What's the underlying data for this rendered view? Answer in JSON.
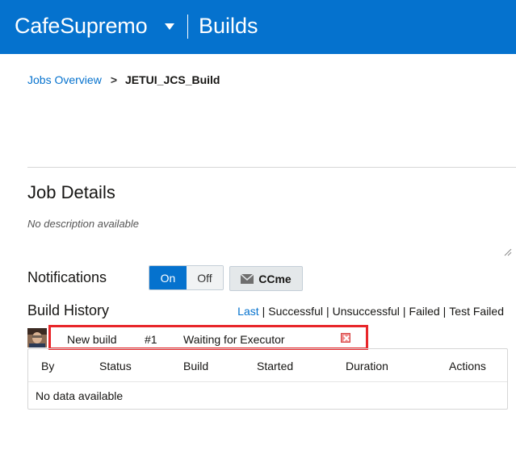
{
  "header": {
    "brand": "CafeSupremo",
    "section": "Builds"
  },
  "breadcrumb": {
    "parent": "Jobs Overview",
    "separator": ">",
    "current": "JETUI_JCS_Build"
  },
  "job_details": {
    "title": "Job Details",
    "description": "No description available"
  },
  "notifications": {
    "label": "Notifications",
    "on_label": "On",
    "off_label": "Off",
    "ccme_label": "CCme",
    "state": "On"
  },
  "build_history": {
    "title": "Build History",
    "filters": [
      "Last",
      "Successful",
      "Unsuccessful",
      "Failed",
      "Test Failed"
    ],
    "active_filter": "Last",
    "pending_build": {
      "name": "New build",
      "number": "#1",
      "status": "Waiting for Executor"
    },
    "columns": [
      "By",
      "Status",
      "Build",
      "Started",
      "Duration",
      "Actions"
    ],
    "empty_message": "No data available"
  },
  "colors": {
    "header_bg": "#0572ce",
    "accent": "#0572ce",
    "highlight_border": "#e8262a"
  }
}
